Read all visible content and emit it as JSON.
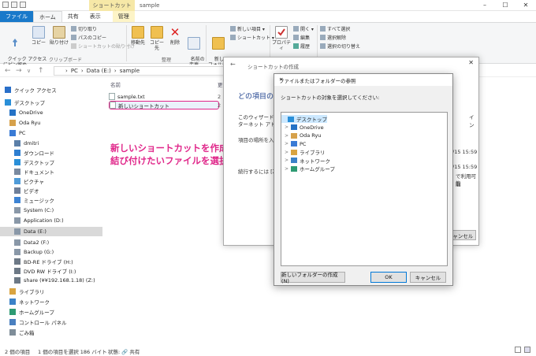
{
  "window": {
    "title": "sample",
    "context_tab": "ショートカット ツール",
    "controls": [
      "–",
      "☐",
      "✕"
    ]
  },
  "ribbon": {
    "tabs": [
      "ファイル",
      "ホーム",
      "共有",
      "表示",
      "管理"
    ],
    "clipboard": {
      "label": "クリップボード",
      "quick_access": "クイック アクセス\nにピン留め",
      "copy": "コピー",
      "paste": "貼り付け",
      "cut": "切り取り",
      "copy_path": "パスのコピー",
      "paste_shortcut": "ショートカットの貼り付け"
    },
    "organize": {
      "label": "整理",
      "move": "移動先",
      "copy_to": "コピー先",
      "delete": "削除",
      "rename": "名前の\n変更"
    },
    "new": {
      "new_folder": "新しい\nフォルダー",
      "new_item": "新しい項目 ▾",
      "shortcut": "ショートカット ▾"
    },
    "open": {
      "properties": "プロパティ",
      "open": "開く ▾",
      "edit": "編集",
      "history": "履歴"
    },
    "select": {
      "select_all": "すべて選択",
      "select_none": "選択解除",
      "invert": "選択の切り替え"
    }
  },
  "address": {
    "crumbs": [
      "PC",
      "Data (E:)",
      "sample"
    ]
  },
  "nav": {
    "items": [
      {
        "label": "クイック アクセス",
        "color": "#2a6fc9",
        "indent": 0,
        "selected": false
      },
      {
        "label": "デスクトップ",
        "color": "#2a8fd8",
        "indent": 0,
        "selected": false
      },
      {
        "label": "OneDrive",
        "color": "#2673c6",
        "indent": 1,
        "selected": false
      },
      {
        "label": "Oda Ryu",
        "color": "#d6a14b",
        "indent": 1,
        "selected": false
      },
      {
        "label": "PC",
        "color": "#3a7bd5",
        "indent": 1,
        "selected": false
      },
      {
        "label": "dmitri",
        "color": "#5b7fa8",
        "indent": 2,
        "selected": false
      },
      {
        "label": "ダウンロード",
        "color": "#2f7fd1",
        "indent": 2,
        "selected": false
      },
      {
        "label": "デスクトップ",
        "color": "#2a8fd8",
        "indent": 2,
        "selected": false
      },
      {
        "label": "ドキュメント",
        "color": "#7a8aa0",
        "indent": 2,
        "selected": false
      },
      {
        "label": "ピクチャ",
        "color": "#4f9bd8",
        "indent": 2,
        "selected": false
      },
      {
        "label": "ビデオ",
        "color": "#6f7f99",
        "indent": 2,
        "selected": false
      },
      {
        "label": "ミュージック",
        "color": "#3d83d4",
        "indent": 2,
        "selected": false
      },
      {
        "label": "System (C:)",
        "color": "#8a98a8",
        "indent": 2,
        "selected": false
      },
      {
        "label": "Application (D:)",
        "color": "#8a98a8",
        "indent": 2,
        "selected": false
      },
      {
        "label": "Data (E:)",
        "color": "#8a98a8",
        "indent": 2,
        "selected": true
      },
      {
        "label": "Data2 (F:)",
        "color": "#8a98a8",
        "indent": 2,
        "selected": false
      },
      {
        "label": "Backup (G:)",
        "color": "#8a98a8",
        "indent": 2,
        "selected": false
      },
      {
        "label": "BD-RE ドライブ (H:)",
        "color": "#6d7986",
        "indent": 2,
        "selected": false
      },
      {
        "label": "DVD RW ドライブ (I:)",
        "color": "#6d7986",
        "indent": 2,
        "selected": false
      },
      {
        "label": "share (¥¥192.168.1.18) (Z:)",
        "color": "#6d7986",
        "indent": 2,
        "selected": false
      },
      {
        "label": "ライブラリ",
        "color": "#d9a441",
        "indent": 1,
        "selected": false
      },
      {
        "label": "ネットワーク",
        "color": "#3b82c8",
        "indent": 1,
        "selected": false
      },
      {
        "label": "ホームグループ",
        "color": "#2e9b73",
        "indent": 1,
        "selected": false
      },
      {
        "label": "コントロール パネル",
        "color": "#4a7fbf",
        "indent": 1,
        "selected": false
      },
      {
        "label": "ごみ箱",
        "color": "#7f8d99",
        "indent": 1,
        "selected": false
      }
    ]
  },
  "files": {
    "column_name": "名前",
    "column_date_partial": "更",
    "items": [
      "sample.txt",
      "新しいショートカット"
    ],
    "date_partial": "2"
  },
  "annotation": {
    "line1": "新しいショートカットを作成し、",
    "line2": "結び付けたいファイルを選択する"
  },
  "status": {
    "count": "2 個の項目",
    "selected": "1 個の項目を選択  186 バイト",
    "state": "状態: 🔗 共有"
  },
  "wizard": {
    "title": "ショートカットの作成",
    "heading": "どの項目のショ",
    "body1": "このウィザードを使",
    "body2": "ターネット アドレス",
    "field_label": "項目の場所を入",
    "next_hint": "続行するには [次",
    "right1": "イン",
    "right2": "/15 15:59",
    "right3": "/15 15:59",
    "right4": "で利用可能",
    "right5": "能",
    "cancel": "キャンセル"
  },
  "dialog": {
    "title": "ファイルまたはフォルダーの参照",
    "close": "✕",
    "prompt": "ショートカットの対象を選択してください:",
    "tree": [
      {
        "label": "デスクトップ",
        "color": "#2a8fd8",
        "expander": "",
        "indent": 0,
        "selected": true
      },
      {
        "label": "OneDrive",
        "color": "#2673c6",
        "expander": ">",
        "indent": 1,
        "selected": false
      },
      {
        "label": "Oda Ryu",
        "color": "#d6a14b",
        "expander": ">",
        "indent": 1,
        "selected": false
      },
      {
        "label": "PC",
        "color": "#3a7bd5",
        "expander": ">",
        "indent": 1,
        "selected": false
      },
      {
        "label": "ライブラリ",
        "color": "#d9a441",
        "expander": ">",
        "indent": 1,
        "selected": false
      },
      {
        "label": "ネットワーク",
        "color": "#3b82c8",
        "expander": ">",
        "indent": 1,
        "selected": false
      },
      {
        "label": "ホームグループ",
        "color": "#2e9b73",
        "expander": ">",
        "indent": 1,
        "selected": false
      }
    ],
    "new_folder": "新しいフォルダーの作成(N)",
    "ok": "OK",
    "cancel": "キャンセル"
  },
  "colors": {
    "accent": "#1979ca",
    "annotation": "#e0278a"
  }
}
